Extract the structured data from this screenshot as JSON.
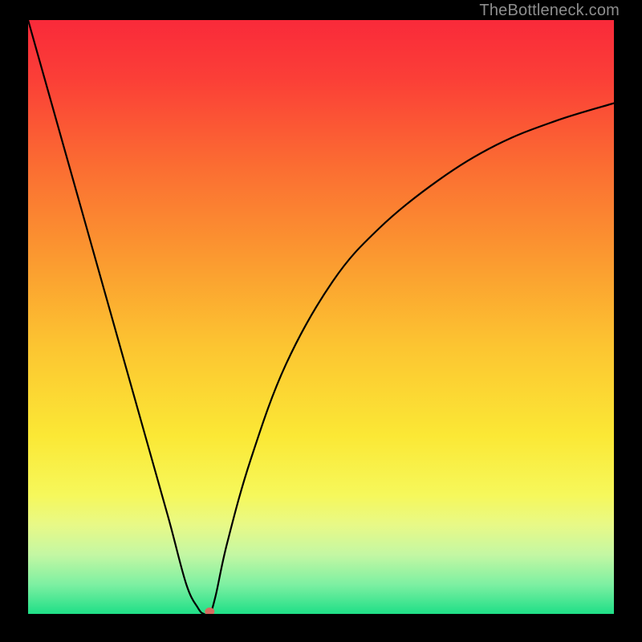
{
  "attribution": "TheBottleneck.com",
  "chart_data": {
    "type": "line",
    "title": "",
    "xlabel": "",
    "ylabel": "",
    "xlim": [
      0,
      100
    ],
    "ylim": [
      0,
      100
    ],
    "grid": false,
    "series": [
      {
        "name": "curve",
        "x": [
          0,
          4,
          8,
          12,
          16,
          20,
          24,
          27,
          29,
          30,
          31,
          32,
          34,
          38,
          44,
          52,
          60,
          70,
          80,
          90,
          100
        ],
        "y": [
          100,
          86,
          72,
          58,
          44,
          30,
          16,
          5,
          1,
          0,
          0,
          3,
          12,
          26,
          42,
          56,
          65,
          73,
          79,
          83,
          86
        ]
      }
    ],
    "marker": {
      "x": 31,
      "y": 0,
      "color": "#d66a5f",
      "rx": 6,
      "ry": 5
    },
    "background_gradient_stops": [
      {
        "offset": 0.0,
        "color": "#f92a3a"
      },
      {
        "offset": 0.1,
        "color": "#fb3f37"
      },
      {
        "offset": 0.25,
        "color": "#fb6e32"
      },
      {
        "offset": 0.4,
        "color": "#fb9930"
      },
      {
        "offset": 0.55,
        "color": "#fcc531"
      },
      {
        "offset": 0.7,
        "color": "#fbe835"
      },
      {
        "offset": 0.8,
        "color": "#f6f85b"
      },
      {
        "offset": 0.85,
        "color": "#e8f987"
      },
      {
        "offset": 0.9,
        "color": "#c4f7a3"
      },
      {
        "offset": 0.95,
        "color": "#7ef0a2"
      },
      {
        "offset": 1.0,
        "color": "#1fdf87"
      }
    ]
  }
}
